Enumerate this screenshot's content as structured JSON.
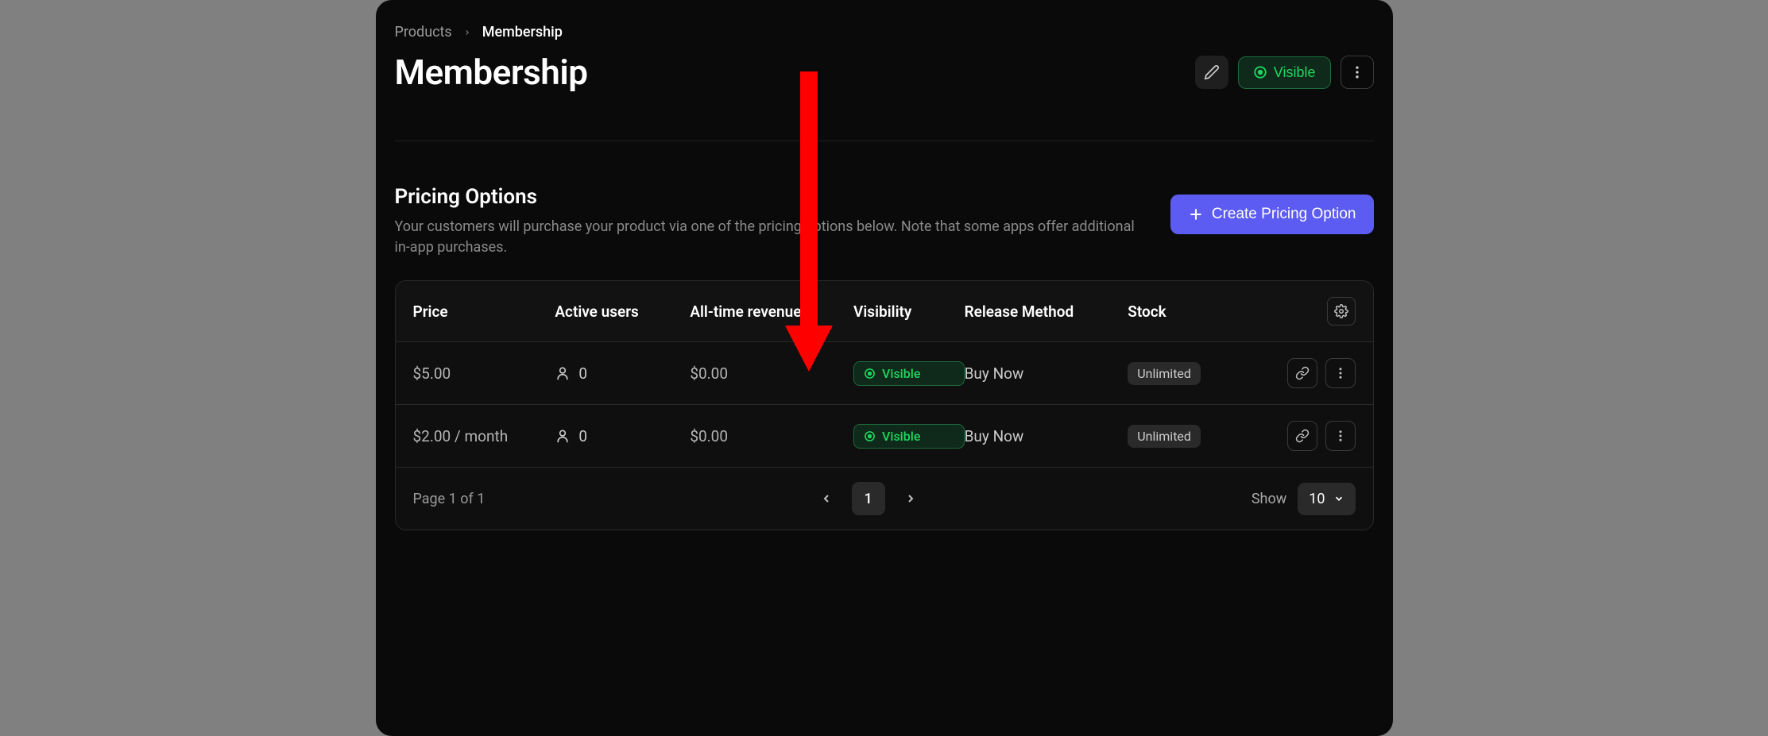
{
  "breadcrumb": {
    "parent": "Products",
    "current": "Membership"
  },
  "header": {
    "title": "Membership",
    "visible_label": "Visible"
  },
  "section": {
    "title": "Pricing Options",
    "description": "Your customers will purchase your product via one of the pricing options below. Note that some apps offer additional in-app purchases.",
    "create_label": "Create Pricing Option"
  },
  "table": {
    "headers": {
      "price": "Price",
      "active_users": "Active users",
      "revenue": "All-time revenue",
      "visibility": "Visibility",
      "release_method": "Release Method",
      "stock": "Stock"
    },
    "rows": [
      {
        "price": "$5.00",
        "active_users": "0",
        "revenue": "$0.00",
        "visibility": "Visible",
        "release_method": "Buy Now",
        "stock": "Unlimited"
      },
      {
        "price": "$2.00 / month",
        "active_users": "0",
        "revenue": "$0.00",
        "visibility": "Visible",
        "release_method": "Buy Now",
        "stock": "Unlimited"
      }
    ]
  },
  "pagination": {
    "page_info": "Page 1 of 1",
    "current_page": "1",
    "show_label": "Show",
    "show_value": "10"
  },
  "colors": {
    "accent_green": "#1ed760",
    "accent_purple": "#5c5cf2",
    "annotation_red": "#ff0000"
  }
}
